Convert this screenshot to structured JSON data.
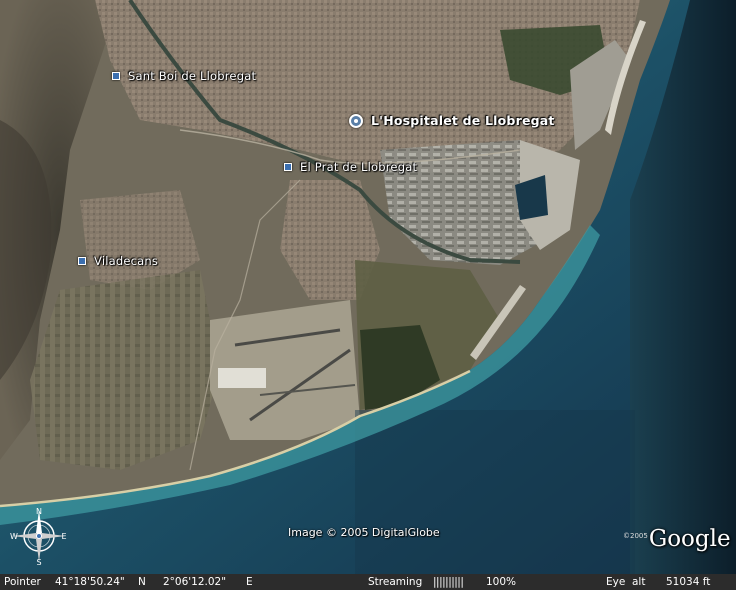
{
  "map": {
    "places": [
      {
        "name": "Sant Boi de Llobregat",
        "marker": "square-marker"
      },
      {
        "name": "L'Hospitalet de Llobregat",
        "marker": "ring-marker"
      },
      {
        "name": "El Prat de Llobregat",
        "marker": "square-marker"
      },
      {
        "name": "Viladecans",
        "marker": "square-marker"
      }
    ],
    "attribution": "Image © 2005 DigitalGlobe",
    "logo": {
      "year": "©2005",
      "word": "Google"
    },
    "compass": {
      "n": "N",
      "e": "E",
      "w": "W",
      "s": "S"
    }
  },
  "status": {
    "pointer_label": "Pointer",
    "latitude": "41°18'50.24\"",
    "lat_hemi": "N",
    "longitude": "2°06'12.02\"",
    "lon_hemi": "E",
    "streaming_label": "Streaming",
    "streaming_bars": "||||||||||",
    "streaming_percent": "100%",
    "eye_label": "Eye  alt",
    "eye_alt": "51034 ft"
  },
  "colors": {
    "sea": "#1f5d73",
    "shallow": "#3f9ca3",
    "land": "#6f6a5a",
    "urban": "#8a7f72",
    "mountain": "#4a463c",
    "beach": "#d9cfa8"
  }
}
